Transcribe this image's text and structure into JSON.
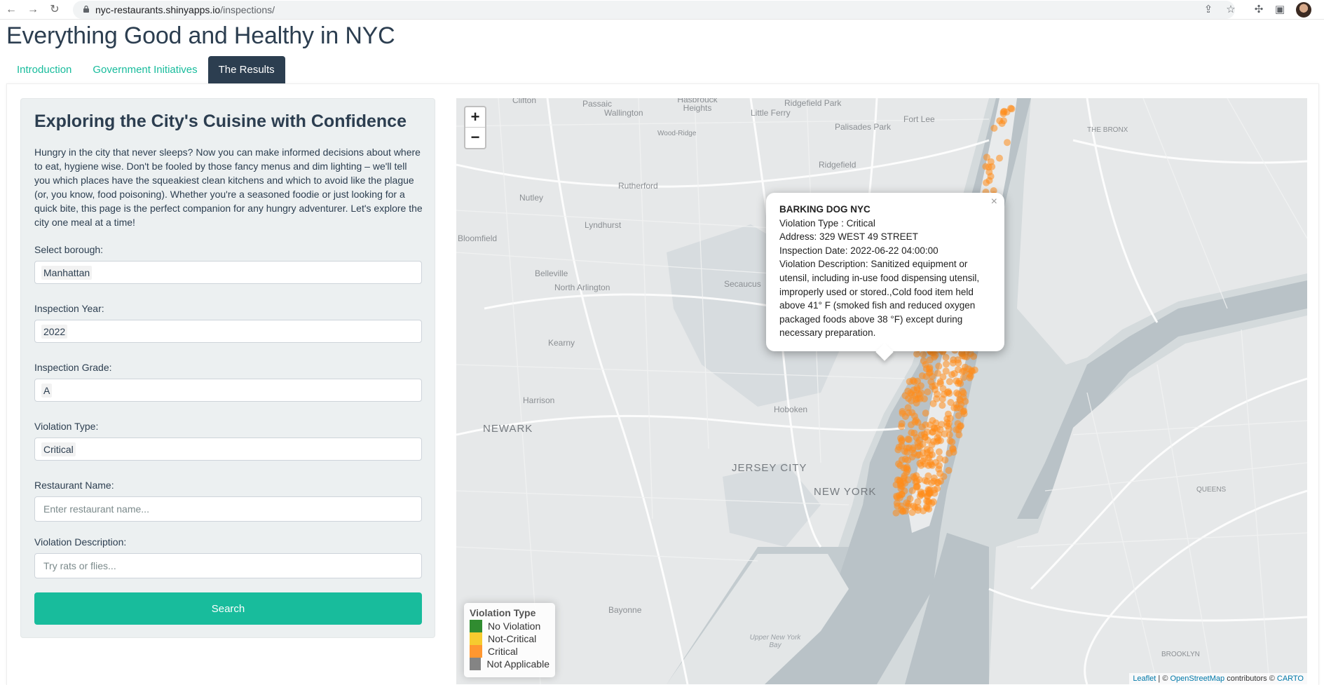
{
  "browser": {
    "url_host": "nyc-restaurants.shinyapps.io",
    "url_path": "/inspections/"
  },
  "app": {
    "title": "Everything Good and Healthy in NYC",
    "tabs": [
      {
        "label": "Introduction",
        "active": false
      },
      {
        "label": "Government Initiatives",
        "active": false
      },
      {
        "label": "The Results",
        "active": true
      }
    ]
  },
  "sidebar": {
    "heading": "Exploring the City's Cuisine with Confidence",
    "intro": "Hungry in the city that never sleeps? Now you can make informed decisions about where to eat, hygiene wise. Don't be fooled by those fancy menus and dim lighting – we'll tell you which places have the squeakiest clean kitchens and which to avoid like the plague (or, you know, food poisoning). Whether you're a seasoned foodie or just looking for a quick bite, this page is the perfect companion for any hungry adventurer. Let's explore the city one meal at a time!",
    "borough": {
      "label": "Select borough:",
      "value": "Manhattan"
    },
    "year": {
      "label": "Inspection Year:",
      "value": "2022"
    },
    "grade": {
      "label": "Inspection Grade:",
      "value": "A"
    },
    "violation_type": {
      "label": "Violation Type:",
      "value": "Critical"
    },
    "restaurant_name": {
      "label": "Restaurant Name:",
      "placeholder": "Enter restaurant name..."
    },
    "violation_description": {
      "label": "Violation Description:",
      "placeholder": "Try rats or flies..."
    },
    "search_label": "Search"
  },
  "map": {
    "zoom_in": "+",
    "zoom_out": "−",
    "places": {
      "clifton": "Clifton",
      "passaic": "Passaic",
      "wallington": "Wallington",
      "hasbrouck_heights": "Hasbrouck Heights",
      "little_ferry": "Little Ferry",
      "ridgefield_park": "Ridgefield Park",
      "palisades_park": "Palisades Park",
      "fort_lee": "Fort Lee",
      "the_bronx": "THE BRONX",
      "wood_ridge": "Wood-Ridge",
      "ridgefield": "Ridgefield",
      "rutherford": "Rutherford",
      "nutley": "Nutley",
      "lyndhurst": "Lyndhurst",
      "bloomfield": "Bloomfield",
      "belleville": "Belleville",
      "north_arlington": "North Arlington",
      "secaucus": "Secaucus",
      "kearny": "Kearny",
      "harrison": "Harrison",
      "hoboken": "Hoboken",
      "newark": "NEWARK",
      "jersey_city": "JERSEY CITY",
      "new_york": "NEW YORK",
      "queens": "QUEENS",
      "bayonne": "Bayonne",
      "upper_new_york_bay": "Upper New York Bay",
      "brooklyn": "BROOKLYN"
    },
    "popup": {
      "title": "BARKING DOG NYC",
      "violation_type": "Violation Type : Critical",
      "address": "Address: 329 WEST 49 STREET",
      "inspection_date": "Inspection Date: 2022-06-22 04:00:00",
      "description": "Violation Description: Sanitized equipment or utensil, including in-use food dispensing utensil, improperly used or stored.,Cold food item held above 41° F (smoked fish and reduced oxygen packaged foods above 38 °F) except during necessary preparation.",
      "close": "×"
    },
    "legend": {
      "title": "Violation Type",
      "items": [
        {
          "label": "No Violation",
          "color": "#1a7f1a"
        },
        {
          "label": "Not-Critical",
          "color": "#f5c518"
        },
        {
          "label": "Critical",
          "color": "#ff8c1a"
        },
        {
          "label": "Not Applicable",
          "color": "#777777"
        }
      ]
    },
    "attribution": {
      "leaflet": "Leaflet",
      "sep": " | © ",
      "osm": "OpenStreetMap",
      "contributors": " contributors © ",
      "carto": "CARTO"
    },
    "marker_color": "#ff8c1a"
  }
}
